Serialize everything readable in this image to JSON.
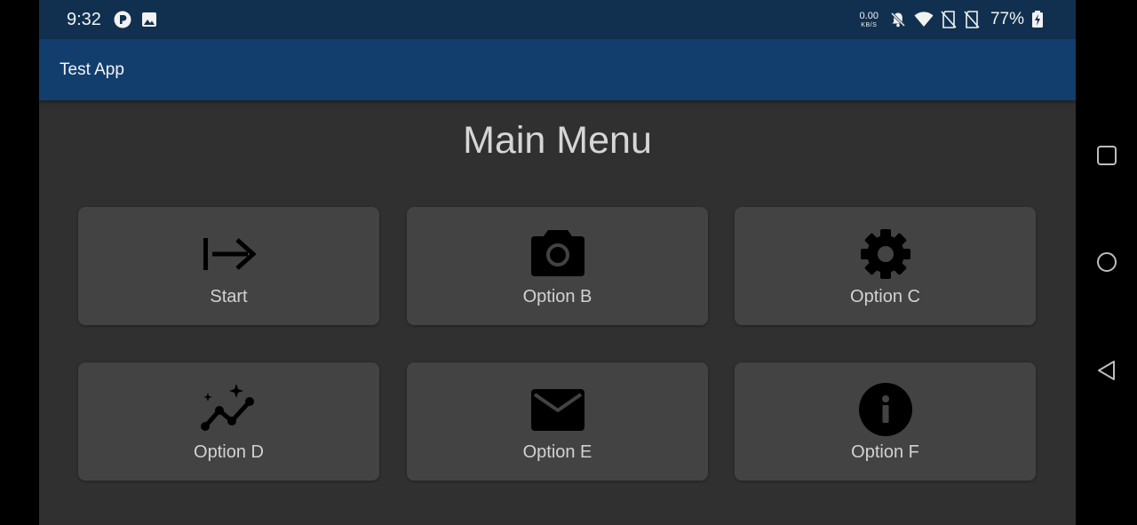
{
  "status_bar": {
    "time": "9:32",
    "net_speed_value": "0.00",
    "net_speed_unit": "KB/S",
    "battery_percent": "77%",
    "left_icons": [
      "app-notification-icon",
      "image-icon"
    ],
    "right_icons": [
      "bell-off-icon",
      "wifi-icon",
      "no-sim-icon",
      "no-sim-icon",
      "battery-charging-icon"
    ]
  },
  "app_bar": {
    "title": "Test App"
  },
  "main": {
    "title": "Main Menu"
  },
  "tiles": [
    {
      "label": "Start",
      "icon": "start-arrow-icon"
    },
    {
      "label": "Option B",
      "icon": "camera-icon"
    },
    {
      "label": "Option C",
      "icon": "gear-icon"
    },
    {
      "label": "Option D",
      "icon": "sparkle-chart-icon"
    },
    {
      "label": "Option E",
      "icon": "mail-icon"
    },
    {
      "label": "Option F",
      "icon": "info-icon"
    }
  ],
  "nav_bar": {
    "buttons": [
      "recent-apps-icon",
      "home-icon",
      "back-icon"
    ]
  },
  "colors": {
    "status_bar": "#11304f",
    "app_bar": "#123e6e",
    "background": "#303030",
    "tile": "#434343",
    "icon": "#000000",
    "text": "#d2d2d2"
  }
}
